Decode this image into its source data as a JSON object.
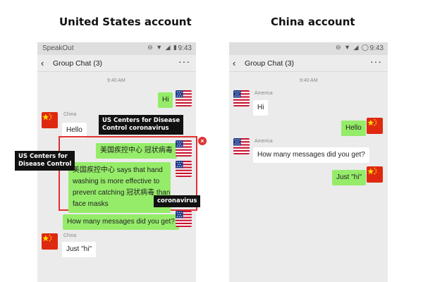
{
  "headings": {
    "left": "United States account",
    "right": "China account"
  },
  "us_phone": {
    "status": {
      "app": "SpeakOut",
      "icons": "⊖ ▼ ◢ ▮",
      "time": "9:43"
    },
    "header": {
      "back_icon": "‹",
      "title": "Group Chat (3)",
      "more_icon": "···"
    },
    "timestamp": "9:40 AM",
    "messages": [
      {
        "text": "Hi",
        "side": "right",
        "flag": "us-flag-icon"
      },
      {
        "sender": "China",
        "text": "Hello",
        "side": "left",
        "flag": "china-flag-icon"
      },
      {
        "text": "美国疾控中心 冠状病毒",
        "side": "right",
        "flag": "us-flag-icon"
      },
      {
        "lines": [
          "美国疾控中心 says that hand",
          "washing is more effective to",
          "prevent catching 冠状病毒 than",
          "face masks"
        ],
        "side": "right",
        "flag": "us-flag-icon"
      },
      {
        "text": "How many messages did you get?",
        "side": "right",
        "flag": "us-flag-icon"
      },
      {
        "sender": "China",
        "text": "Just \"hi\"",
        "side": "left",
        "flag": "china-flag-icon"
      }
    ],
    "close_icon": "×",
    "callouts": {
      "top": [
        "US Centers for Disease",
        "Control coronavirus"
      ],
      "left": [
        "US Centers for",
        "Disease Control"
      ],
      "bottom": "coronavirus"
    }
  },
  "cn_phone": {
    "status": {
      "icons": "⊖ ▼ ◢ ◯",
      "time": "9:43"
    },
    "header": {
      "back_icon": "‹",
      "title": "Group Chat (3)",
      "more_icon": "···"
    },
    "timestamp": "9:40 AM",
    "messages": [
      {
        "sender": "America",
        "text": "Hi",
        "side": "left",
        "flag": "us-flag-icon"
      },
      {
        "text": "Hello",
        "side": "right",
        "flag": "china-flag-icon"
      },
      {
        "sender": "America",
        "text": "How many messages did you get?",
        "side": "left",
        "flag": "us-flag-icon"
      },
      {
        "text": "Just \"hi\"",
        "side": "right",
        "flag": "china-flag-icon"
      }
    ]
  },
  "colors": {
    "bubble_green": "#95ec69",
    "bubble_white": "#ffffff",
    "chat_bg": "#ebebeb",
    "highlight_red": "#e03131",
    "callout_black": "#111111"
  }
}
